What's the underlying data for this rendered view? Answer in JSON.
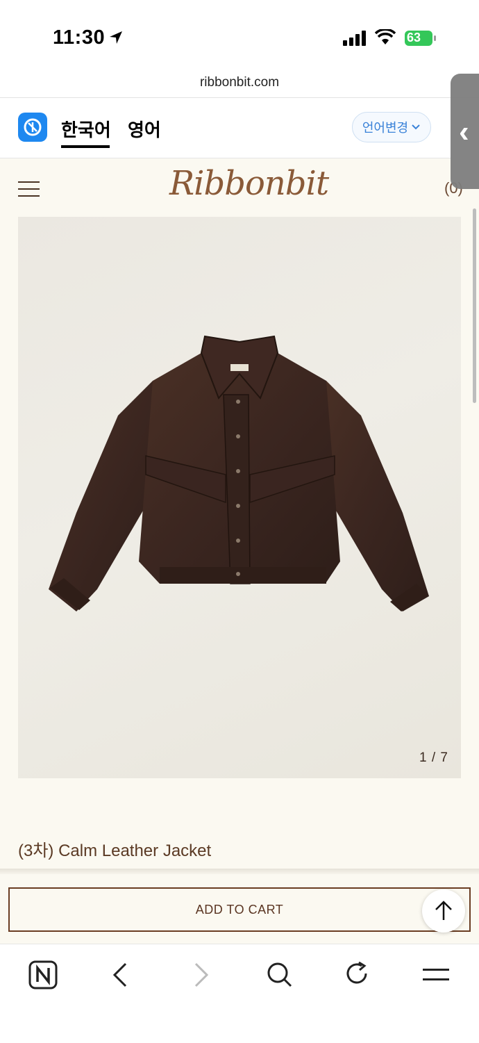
{
  "status_bar": {
    "time": "11:30",
    "battery": "63"
  },
  "browser": {
    "url": "ribbonbit.com"
  },
  "translate_bar": {
    "tabs": [
      "한국어",
      "영어"
    ],
    "language_button": "언어변경"
  },
  "site": {
    "logo": "Ribbonbit",
    "cart_count": "(0)"
  },
  "product": {
    "image_counter": "1 / 7",
    "title": "(3차) Calm Leather Jacket",
    "add_to_cart": "ADD TO CART"
  },
  "colors": {
    "page_bg": "#fbf9f1",
    "accent_brown": "#6a3d22",
    "link_blue": "#3a82d8",
    "papago_blue": "#1e88f0"
  }
}
